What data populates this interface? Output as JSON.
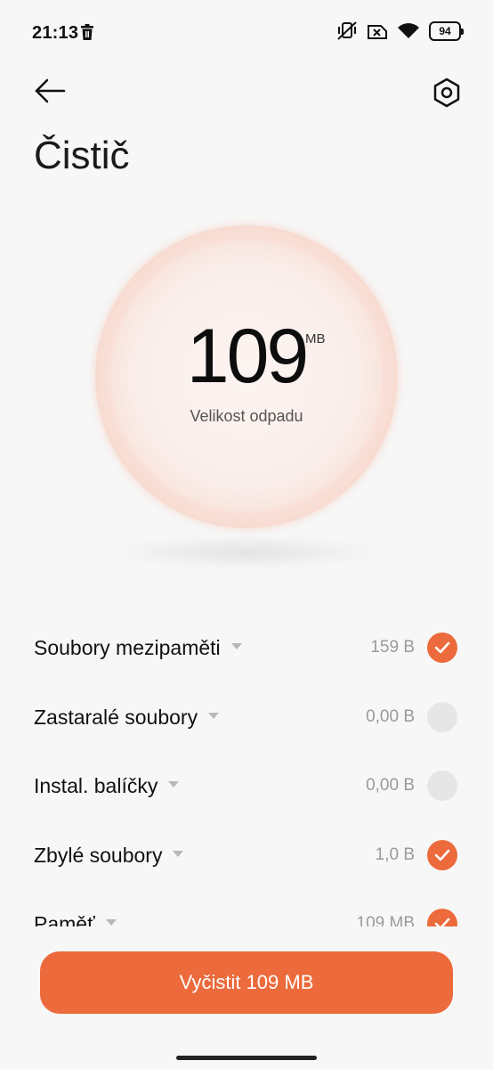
{
  "status_bar": {
    "time": "21:13",
    "battery": "94",
    "icons": [
      "trash-icon",
      "mute-vibrate-icon",
      "no-sim-icon",
      "wifi-icon",
      "battery-icon"
    ]
  },
  "header": {
    "title": "Čistič",
    "back_icon": "arrow-left-icon",
    "settings_icon": "settings-hexagon-icon"
  },
  "summary": {
    "value": "109",
    "unit": "MB",
    "caption": "Velikost odpadu"
  },
  "items": [
    {
      "label": "Soubory mezipaměti",
      "value": "159 B",
      "checked": true
    },
    {
      "label": "Zastaralé soubory",
      "value": "0,00 B",
      "checked": false
    },
    {
      "label": "Instal. balíčky",
      "value": "0,00 B",
      "checked": false
    },
    {
      "label": "Zbylé soubory",
      "value": "1,0 B",
      "checked": true
    },
    {
      "label": "Paměť",
      "value": "109 MB",
      "checked": true
    }
  ],
  "action": {
    "label": "Vyčistit 109 MB"
  },
  "colors": {
    "accent": "#ec6a3b",
    "unchecked": "#e6e6e6",
    "background": "#f7f7f7"
  }
}
